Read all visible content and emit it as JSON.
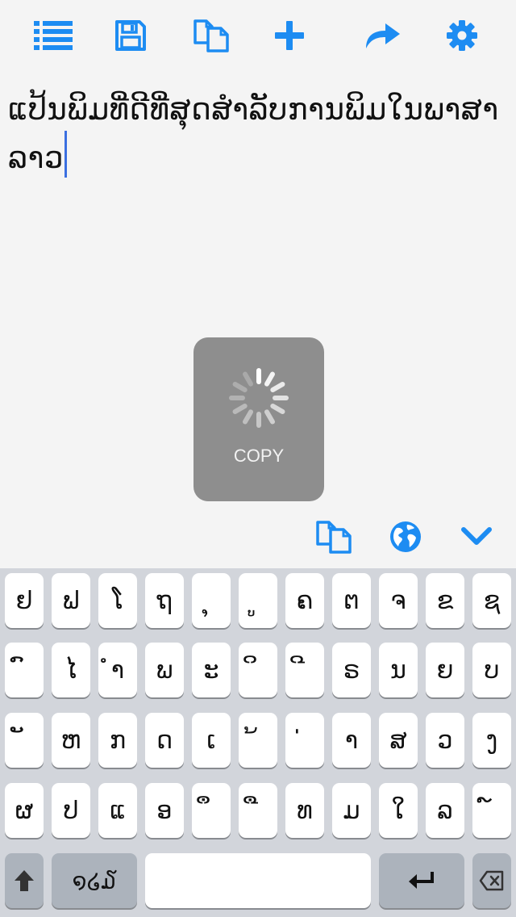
{
  "toolbar": {
    "icons": [
      "list-icon",
      "save-icon",
      "copy-icon",
      "plus-icon",
      "share-icon",
      "gear-icon"
    ]
  },
  "editor": {
    "text": "ແປ້ນພິມທີ່ດີທີ່ສຸດສຳລັບການພິມໃນພາສາລາວ"
  },
  "hud": {
    "label": "COPY"
  },
  "accessory": {
    "icons": [
      "copy-icon",
      "globe-icon",
      "chevron-down-icon"
    ]
  },
  "keyboard": {
    "row1": [
      "ຢ",
      "ຟ",
      "ໂ",
      "ຖ",
      "ຸ",
      "ູ",
      "ຄ",
      "ຕ",
      "ຈ",
      "ຂ",
      "ຊ"
    ],
    "row2": [
      "ົ",
      "ໄ",
      "ຳ",
      "ພ",
      "ະ",
      "ິ",
      "ີ",
      "ຣ",
      "ນ",
      "ຍ",
      "ບ"
    ],
    "row3": [
      "ັ",
      "ຫ",
      "ກ",
      "ດ",
      "ເ",
      "້",
      "່",
      "າ",
      "ສ",
      "ວ",
      "ງ"
    ],
    "row4": [
      "ຜ",
      "ປ",
      "ແ",
      "ອ",
      "ຶ",
      "ື",
      "ທ",
      "ມ",
      "ໃ",
      "ລ",
      "໌"
    ],
    "numbers_label": "໑໒໓",
    "space_label": "",
    "colors": {
      "background": "#d2d5db",
      "key": "#ffffff",
      "dark_key": "#acb3bc",
      "accent": "#1d8cf2"
    }
  }
}
